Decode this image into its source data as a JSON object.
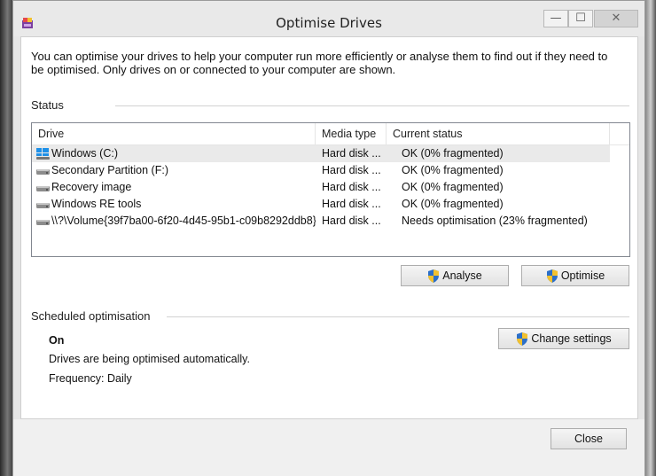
{
  "window": {
    "title": "Optimise Drives",
    "controls": {
      "minimize": "—",
      "maximize": "☐",
      "close": "✕"
    }
  },
  "description": "You can optimise your drives to help your computer run more efficiently or analyse them to find out if they need to be optimised. Only drives on or connected to your computer are shown.",
  "status": {
    "group_label": "Status",
    "columns": [
      "Drive",
      "Media type",
      "Current status"
    ],
    "rows": [
      {
        "drive": "Windows (C:)",
        "media": "Hard disk ...",
        "status": "OK (0% fragmented)",
        "icon": "windows-drive-icon",
        "selected": true
      },
      {
        "drive": "Secondary Partition  (F:)",
        "media": "Hard disk ...",
        "status": "OK (0% fragmented)",
        "icon": "hard-disk-icon",
        "selected": false
      },
      {
        "drive": "Recovery image",
        "media": "Hard disk ...",
        "status": "OK (0% fragmented)",
        "icon": "hard-disk-icon",
        "selected": false
      },
      {
        "drive": "Windows RE tools",
        "media": "Hard disk ...",
        "status": "OK (0% fragmented)",
        "icon": "hard-disk-icon",
        "selected": false
      },
      {
        "drive": "\\\\?\\Volume{39f7ba00-6f20-4d45-95b1-c09b8292ddb8}\\",
        "media": "Hard disk ...",
        "status": "Needs optimisation (23% fragmented)",
        "icon": "hard-disk-icon",
        "selected": false
      }
    ],
    "analyse_label": "Analyse",
    "optimise_label": "Optimise"
  },
  "schedule": {
    "group_label": "Scheduled optimisation",
    "state": "On",
    "detail": "Drives are being optimised automatically.",
    "frequency": "Frequency: Daily",
    "change_label": "Change settings"
  },
  "footer": {
    "close_label": "Close"
  },
  "colors": {
    "selected_row": "#eaeaea",
    "window_bg": "#e6e6e6",
    "shield_blue": "#2b6fc9",
    "shield_yellow": "#f2c12e"
  }
}
